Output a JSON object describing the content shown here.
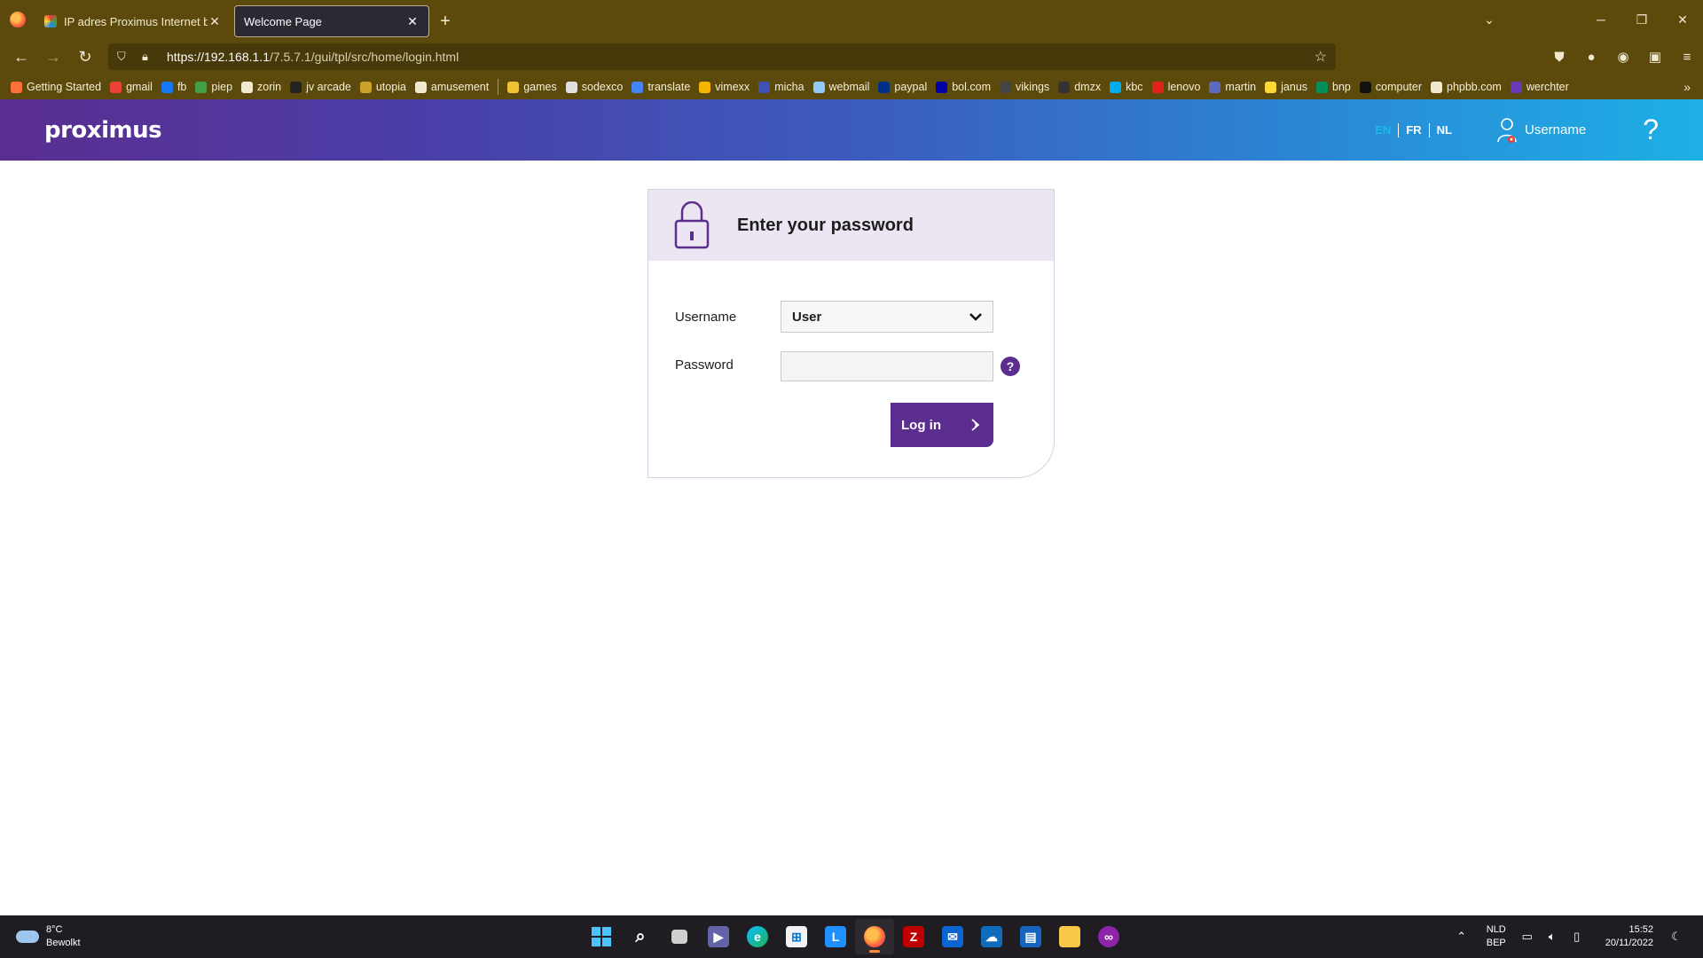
{
  "browser": {
    "tabs": [
      {
        "title": "IP adres Proximus Internet box",
        "active": false
      },
      {
        "title": "Welcome Page",
        "active": true
      }
    ],
    "url": {
      "host": "https://192.168.1.1",
      "path": "/7.5.7.1/gui/tpl/src/home/login.html"
    },
    "bookmarks": [
      {
        "label": "Getting Started",
        "color": "#ff7139"
      },
      {
        "label": "gmail",
        "color": "#ea4335"
      },
      {
        "label": "fb",
        "color": "#1877f2"
      },
      {
        "label": "piep",
        "color": "#43a047"
      },
      {
        "label": "zorin",
        "color": "#f1ead0"
      },
      {
        "label": "jv arcade",
        "color": "#222222"
      },
      {
        "label": "utopia",
        "color": "#c9a227"
      },
      {
        "label": "amusement",
        "color": "#f1ead0"
      },
      {
        "label": "games",
        "color": "#f1c232"
      },
      {
        "label": "sodexco",
        "color": "#e0e0e0"
      },
      {
        "label": "translate",
        "color": "#4285f4"
      },
      {
        "label": "vimexx",
        "color": "#f4b400"
      },
      {
        "label": "micha",
        "color": "#3f51b5"
      },
      {
        "label": "webmail",
        "color": "#90caf9"
      },
      {
        "label": "paypal",
        "color": "#003087"
      },
      {
        "label": "bol.com",
        "color": "#0000a4"
      },
      {
        "label": "vikings",
        "color": "#444444"
      },
      {
        "label": "dmzx",
        "color": "#333333"
      },
      {
        "label": "kbc",
        "color": "#00aeef"
      },
      {
        "label": "lenovo",
        "color": "#e2231a"
      },
      {
        "label": "martin",
        "color": "#5c6bc0"
      },
      {
        "label": "janus",
        "color": "#fdd835"
      },
      {
        "label": "bnp",
        "color": "#00915a"
      },
      {
        "label": "computer",
        "color": "#111111"
      },
      {
        "label": "phpbb.com",
        "color": "#f1ead0"
      },
      {
        "label": "werchter",
        "color": "#673ab7"
      }
    ]
  },
  "header": {
    "logo": "proximus",
    "languages": [
      "EN",
      "FR",
      "NL"
    ],
    "active_language": "EN",
    "user_label": "Username"
  },
  "login": {
    "title": "Enter your password",
    "username_label": "Username",
    "username_value": "User",
    "password_label": "Password",
    "password_help": "?",
    "login_button": "Log in"
  },
  "taskbar": {
    "weather_temp": "8°C",
    "weather_text": "Bewolkt",
    "lang_top": "NLD",
    "lang_bottom": "BEP",
    "time": "15:52",
    "date": "20/11/2022"
  },
  "colors": {
    "brand_purple": "#5b2d8e",
    "header_gradient_start": "#5a2d90",
    "header_gradient_end": "#1db0e6",
    "browser_chrome": "#5c4a0c"
  }
}
